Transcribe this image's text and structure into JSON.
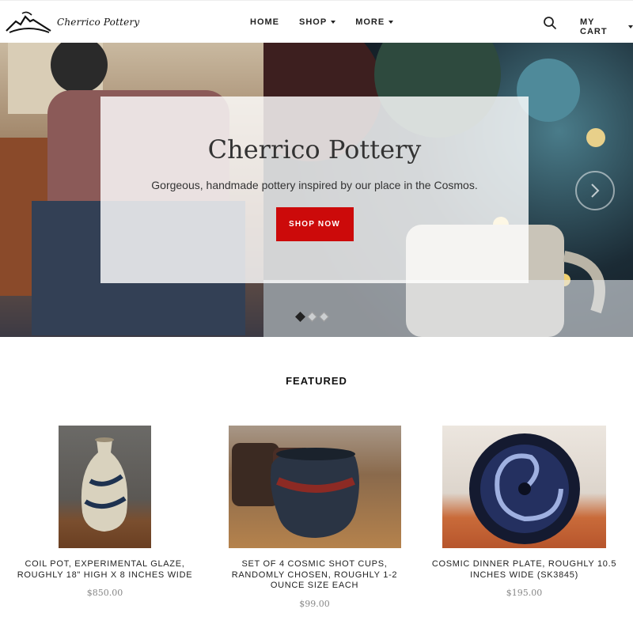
{
  "header": {
    "brand": "Cherrico Pottery",
    "nav": [
      {
        "label": "HOME"
      },
      {
        "label": "SHOP"
      },
      {
        "label": "MORE"
      }
    ],
    "cart_label": "MY CART"
  },
  "hero": {
    "title": "Cherrico Pottery",
    "subtitle": "Gorgeous, handmade pottery inspired by our place in the Cosmos.",
    "button": "SHOP NOW",
    "slides_count": 3,
    "active_slide": 1
  },
  "featured": {
    "heading": "FEATURED",
    "products": [
      {
        "name": "COIL POT, EXPERIMENTAL GLAZE, ROUGHLY 18\" HIGH X 8 INCHES WIDE",
        "price": "$850.00"
      },
      {
        "name": "SET OF 4 COSMIC SHOT CUPS, RANDOMLY CHOSEN, ROUGHLY 1-2 OUNCE SIZE EACH",
        "price": "$99.00"
      },
      {
        "name": "COSMIC DINNER PLATE, ROUGHLY 10.5 INCHES WIDE (SK3845)",
        "price": "$195.00"
      }
    ]
  },
  "colors": {
    "accent": "#cc0a0a",
    "price": "#888888"
  },
  "icons": {
    "search": "search-icon",
    "next": "chevron-right-icon",
    "logo": "pottery-logo-icon"
  }
}
